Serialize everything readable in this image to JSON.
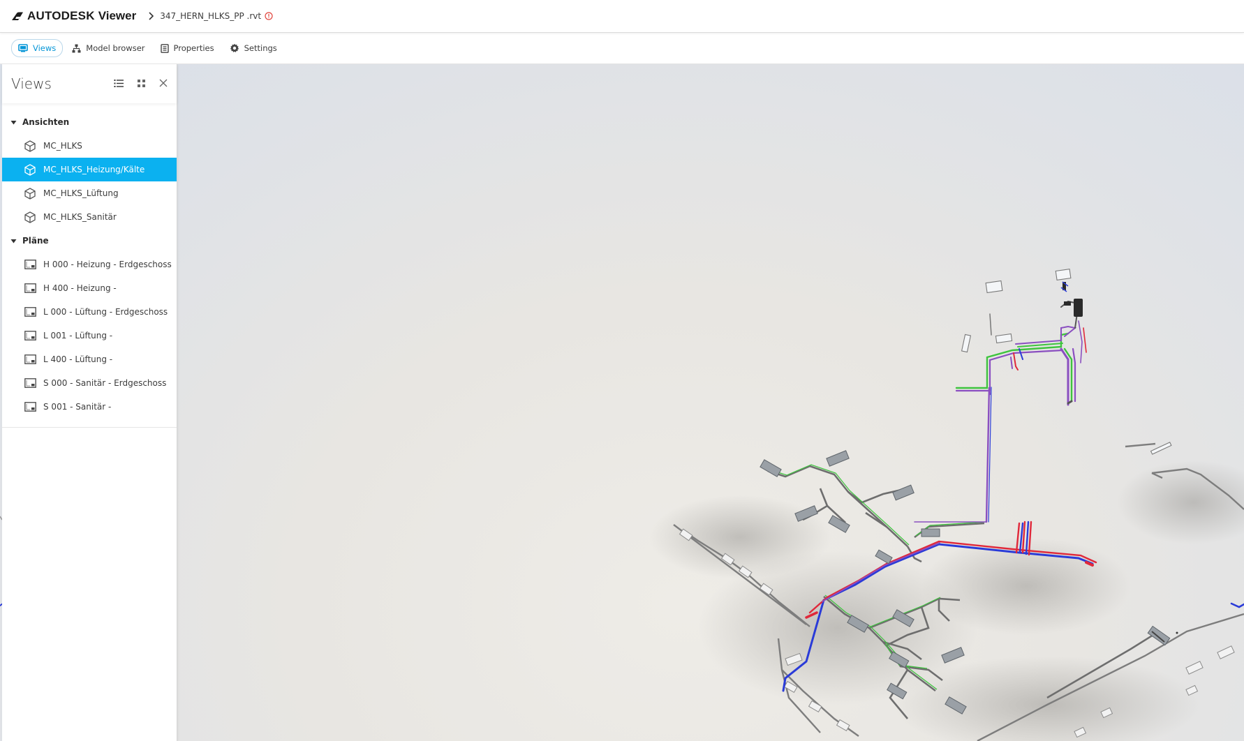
{
  "header": {
    "brand": "AUTODESK",
    "product": "Viewer",
    "file_name": "347_HERN_HLKS_PP .rvt"
  },
  "tabs": [
    {
      "label": "Views",
      "icon": "views-icon",
      "active": true
    },
    {
      "label": "Model browser",
      "icon": "hierarchy-icon",
      "active": false
    },
    {
      "label": "Properties",
      "icon": "document-icon",
      "active": false
    },
    {
      "label": "Settings",
      "icon": "gear-icon",
      "active": false
    }
  ],
  "panel": {
    "title": "Views",
    "groups": [
      {
        "label": "Ansichten",
        "items": [
          {
            "label": "MC_HLKS",
            "icon": "3d-cube-icon",
            "selected": false
          },
          {
            "label": "MC_HLKS_Heizung/Kälte",
            "icon": "3d-cube-icon",
            "selected": true
          },
          {
            "label": "MC_HLKS_Lüftung",
            "icon": "3d-cube-icon",
            "selected": false
          },
          {
            "label": "MC_HLKS_Sanitär",
            "icon": "3d-cube-icon",
            "selected": false
          }
        ]
      },
      {
        "label": "Pläne",
        "items": [
          {
            "label": "H 000 - Heizung - Erdgeschoss",
            "icon": "sheet-icon",
            "selected": false
          },
          {
            "label": "H 400 - Heizung -",
            "icon": "sheet-icon",
            "selected": false
          },
          {
            "label": "L 000 - Lüftung - Erdgeschoss",
            "icon": "sheet-icon",
            "selected": false
          },
          {
            "label": "L 001 - Lüftung -",
            "icon": "sheet-icon",
            "selected": false
          },
          {
            "label": "L 400 - Lüftung -",
            "icon": "sheet-icon",
            "selected": false
          },
          {
            "label": "S 000 - Sanitär - Erdgeschoss",
            "icon": "sheet-icon",
            "selected": false
          },
          {
            "label": "S 001 - Sanitär -",
            "icon": "sheet-icon",
            "selected": false
          }
        ]
      }
    ]
  },
  "colors": {
    "accent": "#0696d7",
    "selected_row": "#0bb1f0",
    "pipe_green": "#3ec43e",
    "pipe_purple": "#8a4fc0",
    "pipe_red": "#e0283a",
    "pipe_blue": "#2a3bd8",
    "warning": "#e0443c"
  }
}
